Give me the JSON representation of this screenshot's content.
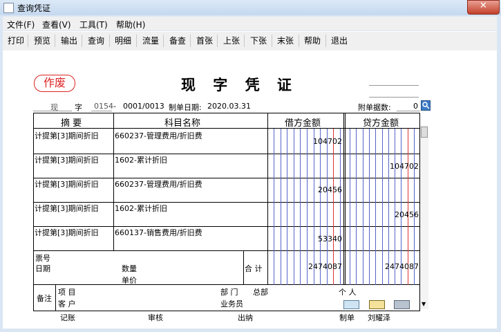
{
  "window": {
    "title": "查询凭证"
  },
  "menu": [
    "文件(F)",
    "查看(V)",
    "工具(T)",
    "帮助(H)"
  ],
  "toolbar": [
    "打印",
    "预览",
    "输出",
    "查询",
    "明细",
    "流量",
    "备查",
    "首张",
    "上张",
    "下张",
    "末张",
    "帮助",
    "退出"
  ],
  "voucher": {
    "void_stamp": "作废",
    "title": "现 字 凭 证",
    "type_label": "现",
    "zi_label": "字",
    "number": "0154",
    "dash": "-",
    "sub_number": "0001/0013",
    "date_label": "制单日期:",
    "date": "2020.03.31",
    "attachments_label": "附单据数:",
    "attachments": "0"
  },
  "table": {
    "headers": {
      "summary": "摘 要",
      "account": "科目名称",
      "debit": "借方金额",
      "credit": "贷方金额"
    },
    "rows": [
      {
        "summary": "计提第[3]期间折旧",
        "account": "660237-管理费用/折旧费",
        "debit": "104702",
        "credit": ""
      },
      {
        "summary": "计提第[3]期间折旧",
        "account": "1602-累计折旧",
        "debit": "",
        "credit": "104702"
      },
      {
        "summary": "计提第[3]期间折旧",
        "account": "660237-管理费用/折旧费",
        "debit": "20456",
        "credit": ""
      },
      {
        "summary": "计提第[3]期间折旧",
        "account": "1602-累计折旧",
        "debit": "",
        "credit": "20456"
      },
      {
        "summary": "计提第[3]期间折旧",
        "account": "660137-销售费用/折旧费",
        "debit": "53340",
        "credit": ""
      }
    ],
    "footer": {
      "ticket_no": "票号",
      "date": "日期",
      "quantity": "数量",
      "unit_price": "单价",
      "total_label": "合 计",
      "total_debit": "2474087",
      "total_credit": "2474087"
    },
    "notes": {
      "label": "备注",
      "project": "项 目",
      "department_label": "部 门",
      "department": "总部",
      "person": "个 人",
      "customer": "客 户",
      "salesperson": "业务员"
    }
  },
  "signatures": {
    "bookkeeping": "记账",
    "review": "审核",
    "cashier": "出纳",
    "maker_label": "制单",
    "maker": "刘耀泽"
  }
}
